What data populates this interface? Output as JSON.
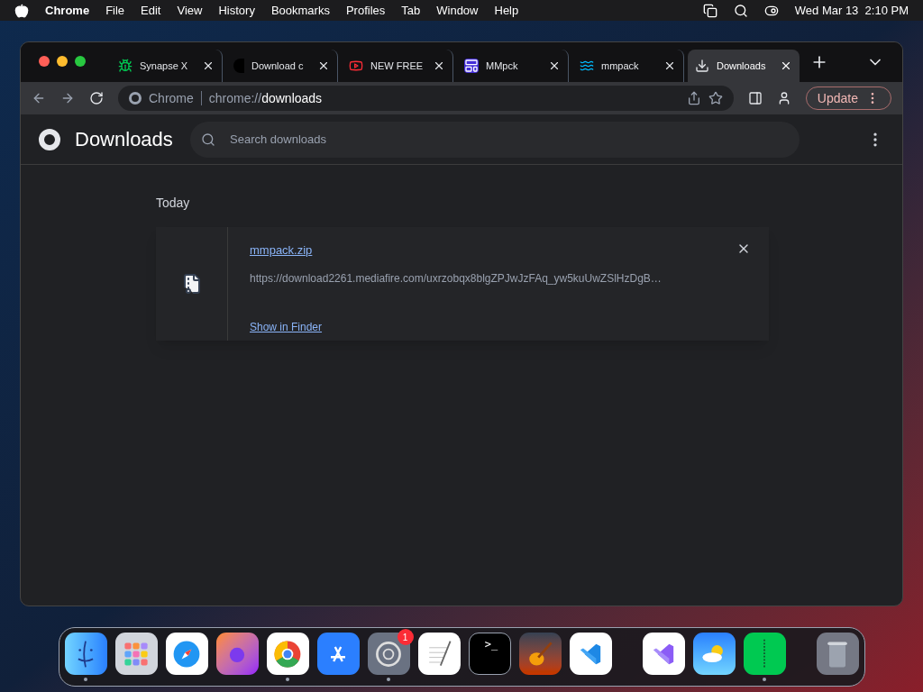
{
  "menu_bar": {
    "app": "Chrome",
    "items": [
      "File",
      "Edit",
      "View",
      "History",
      "Bookmarks",
      "Profiles",
      "Tab",
      "Window",
      "Help"
    ],
    "clock": "Wed Mar 13  2:10 PM"
  },
  "tabs": [
    {
      "kind": "bug",
      "title": "Synapse X",
      "selected": false
    },
    {
      "kind": "dark",
      "title": "Download c",
      "selected": false
    },
    {
      "kind": "video",
      "title": "NEW FREE",
      "selected": false
    },
    {
      "kind": "page",
      "title": "MMpck",
      "selected": false
    },
    {
      "kind": "wave",
      "title": "mmpack",
      "selected": false
    },
    {
      "kind": "download",
      "title": "Downloads",
      "selected": true
    }
  ],
  "toolbar": {
    "site": "Chrome",
    "url_scheme": "chrome://",
    "url_host": "downloads",
    "update": "Update"
  },
  "downloads": {
    "title": "Downloads",
    "search": {
      "placeholder": "Search downloads"
    },
    "date": "Today",
    "items": [
      {
        "file": "mmpack.zip",
        "url": "https://download2261.mediafire.com/uxrzobqx8blgZPJwJzFAq_yw5kuUwZSlHzDgB…",
        "action": "Show in Finder"
      }
    ]
  },
  "dock": [
    {
      "kind": "finder",
      "running": true
    },
    {
      "kind": "launchpad",
      "running": false
    },
    {
      "kind": "safari",
      "running": false
    },
    {
      "kind": "firefox",
      "running": false
    },
    {
      "kind": "chrome",
      "running": true
    },
    {
      "kind": "appstore",
      "running": false
    },
    {
      "kind": "settings",
      "running": true,
      "badge": "1"
    },
    {
      "kind": "textedit",
      "running": false
    },
    {
      "kind": "terminal",
      "running": false,
      "glyph": ">_"
    },
    {
      "kind": "guitar",
      "running": false
    },
    {
      "kind": "vscode",
      "running": false
    },
    {
      "kind": "separator"
    },
    {
      "kind": "vs",
      "running": false
    },
    {
      "kind": "weather",
      "running": false
    },
    {
      "kind": "archive",
      "running": true
    },
    {
      "kind": "separator"
    },
    {
      "kind": "trash",
      "running": false
    }
  ]
}
